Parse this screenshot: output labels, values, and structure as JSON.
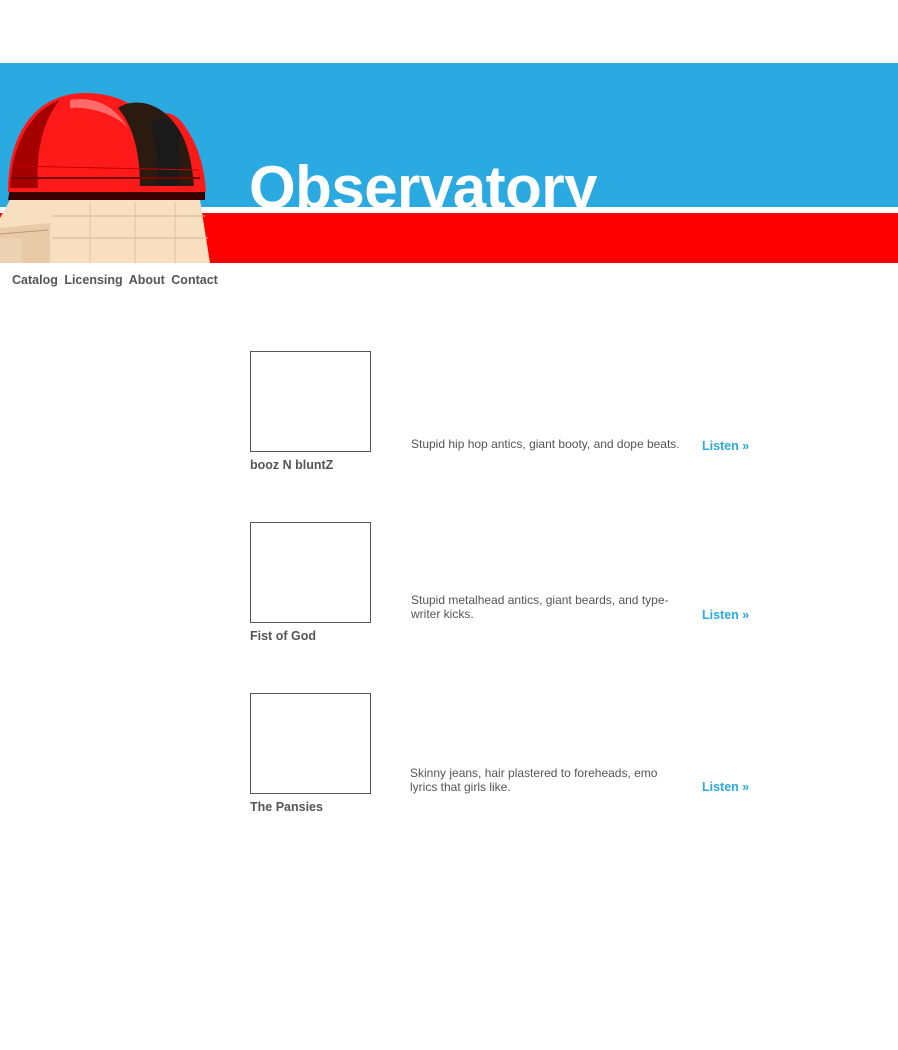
{
  "site": {
    "title": "Observatory"
  },
  "colors": {
    "banner_blue": "#2baae1",
    "banner_red": "#ff0000",
    "link": "#2baae1",
    "text": "#555555"
  },
  "nav": {
    "items": [
      {
        "label": "Catalog"
      },
      {
        "label": "Licensing"
      },
      {
        "label": "About"
      },
      {
        "label": "Contact"
      }
    ]
  },
  "artists": [
    {
      "name": "booz N bluntZ",
      "description": "Stupid hip hop antics, giant booty, and dope beats.",
      "listen_label": "Listen »"
    },
    {
      "name": "Fist of God",
      "description": "Stupid metalhead antics, giant beards, and type-writer kicks.",
      "listen_label": "Listen »"
    },
    {
      "name": "The Pansies",
      "description": "Skinny jeans, hair plastered to foreheads, emo lyrics that girls like.",
      "listen_label": "Listen »"
    }
  ]
}
